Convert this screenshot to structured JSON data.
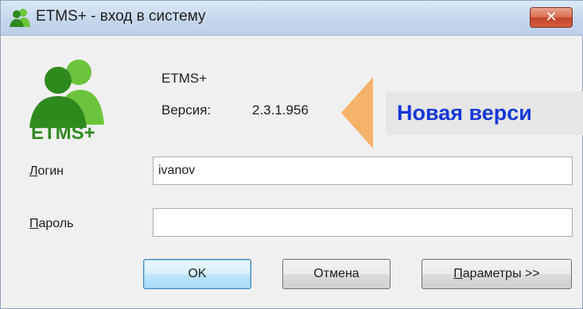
{
  "window": {
    "title": "ETMS+ - вход в систему",
    "close_label": "✕"
  },
  "about": {
    "logo_text": "ETMS+",
    "app_name": "ETMS+",
    "version_label": "Версия:",
    "version_value": "2.3.1.956"
  },
  "callout": {
    "text": "Новая верси"
  },
  "form": {
    "login_label_accel": "Л",
    "login_label_rest": "огин",
    "login_value": "ivanov",
    "password_label_accel": "П",
    "password_label_rest": "ароль",
    "password_value": ""
  },
  "buttons": {
    "ok": "OK",
    "cancel": "Отмена",
    "params_accel": "П",
    "params_rest": "араметры >>"
  },
  "colors": {
    "callout_text": "#1538d6",
    "arrow": "#f5b26b",
    "logo_green": "#2f8a1e",
    "logo_light_green": "#6cc43c"
  }
}
